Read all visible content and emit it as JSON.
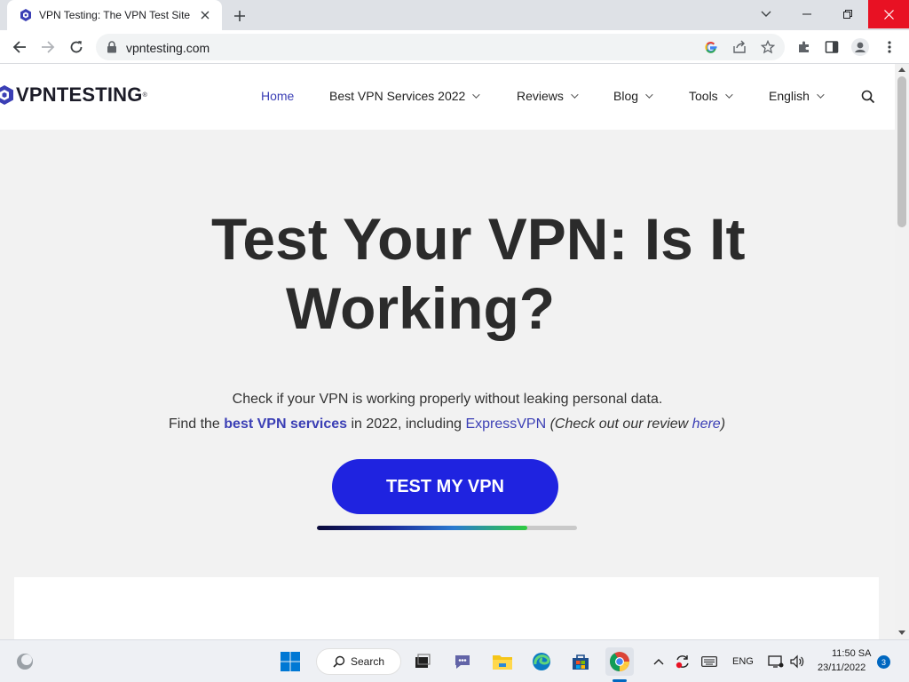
{
  "browser": {
    "tab_title": "VPN Testing: The VPN Test Site",
    "url": "vpntesting.com"
  },
  "site": {
    "logo_bold": "VPNTESTING",
    "logo_reg": "®",
    "menu": [
      {
        "label": "Home",
        "active": true
      },
      {
        "label": "Best VPN Services 2022"
      },
      {
        "label": "Reviews"
      },
      {
        "label": "Blog"
      },
      {
        "label": "Tools"
      },
      {
        "label": "English"
      }
    ]
  },
  "hero": {
    "title_line1": "Test Your VPN: Is It",
    "title_line2": "Working?",
    "subtitle1": "Check if your VPN is working properly without leaking personal data.",
    "subtitle2_prefix": "Find the ",
    "subtitle2_link": "best VPN services",
    "subtitle2_mid": " in 2022, including ",
    "subtitle2_link2": "ExpressVPN",
    "subtitle2_paren_open": " (Check out our review ",
    "subtitle2_here": "here",
    "subtitle2_paren_close": ")",
    "cta_label": "TEST MY VPN",
    "progress_fraction": 0.81
  },
  "taskbar": {
    "search_label": "Search",
    "lang": "ENG",
    "time": "11:50 SA",
    "date": "23/11/2022",
    "notification_count": "3"
  },
  "colors": {
    "accent": "#3b3fb5",
    "cta": "#1f23e0",
    "close_red": "#e81123"
  }
}
